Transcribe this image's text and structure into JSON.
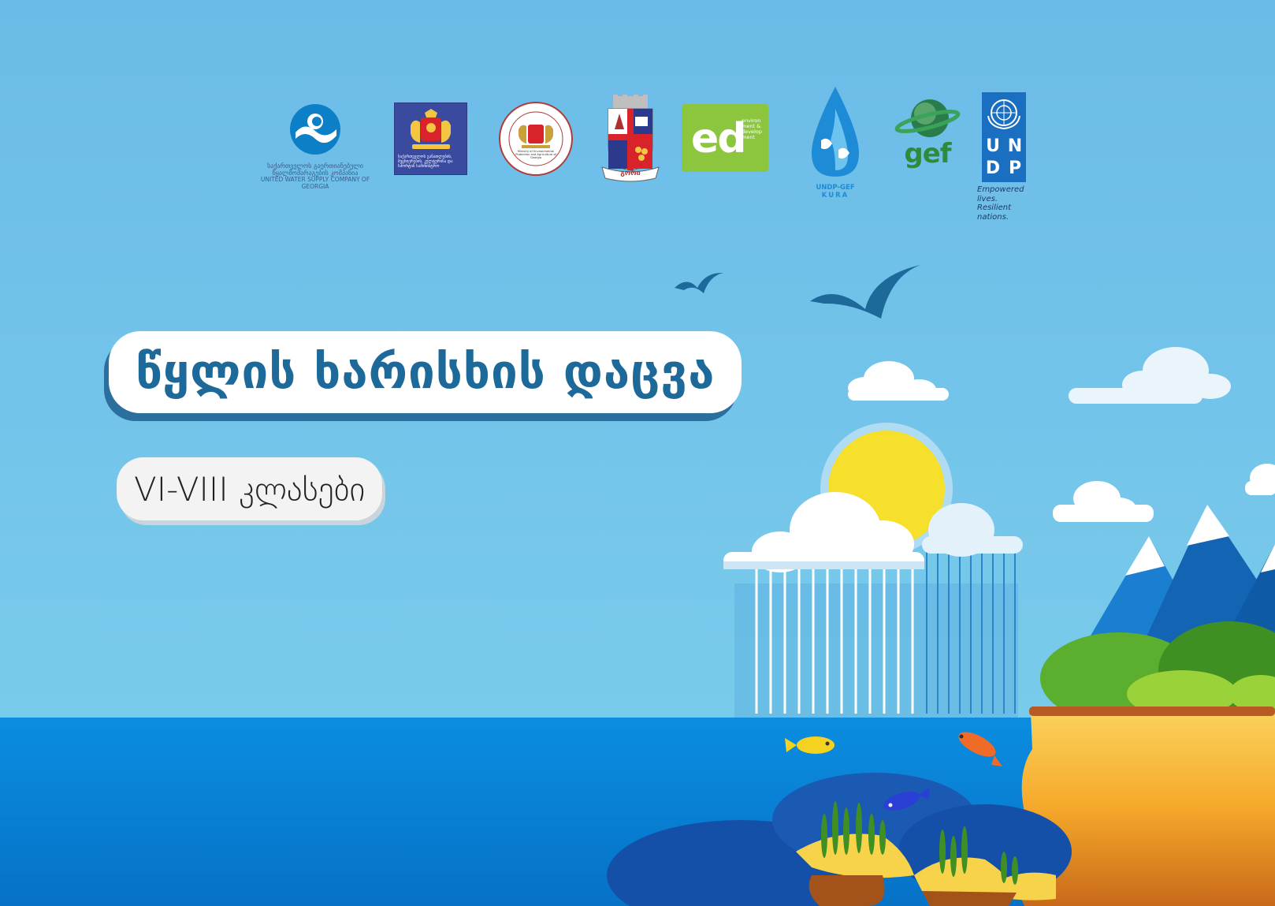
{
  "colors": {
    "sky": "#70bfe8",
    "sea": "#0a8ad8",
    "sea_deep": "#0a6fc0",
    "title_text": "#1d6a9a",
    "title_shadow": "#2a6f9d",
    "sun": "#f7e02b",
    "undp_blue": "#1a6fc0",
    "ed_green": "#8cc63f",
    "gef_green": "#2e8b3c"
  },
  "logos": {
    "water_company": {
      "icon": "wave-g-icon",
      "caption_ka_1": "საქართველოს გაერთიანებული",
      "caption_ka_2": "წყალმომარაგების კომპანია",
      "caption_en": "UNITED WATER SUPPLY COMPANY OF GEORGIA"
    },
    "government": {
      "icon": "coat-of-arms-icon",
      "caption": "საქართველოს განათლების, მეცნიერების, კულტურისა და სპორტის სამინისტრო"
    },
    "ministry_environment": {
      "icon": "seal-icon",
      "caption": "Ministry of Environmental Protection and Agriculture of Georgia"
    },
    "city_emblem": {
      "icon": "city-shield-icon",
      "ribbon": "გორი"
    },
    "ed": {
      "text": "ed",
      "side_text": "environ ment & develop ment"
    },
    "undp_gef_kura": {
      "icon": "water-drop-icon",
      "line1": "UNDP-GEF",
      "line2": "KURA"
    },
    "gef": {
      "icon": "globe-icon",
      "text": "gef"
    },
    "undp": {
      "icon": "un-emblem-icon",
      "letters": [
        "U",
        "N",
        "D",
        "P"
      ],
      "tagline_1": "Empowered lives.",
      "tagline_2": "Resilient nations."
    }
  },
  "title": "წყლის ხარისხის დაცვა",
  "subtitle": "VI-VIII კლასები"
}
